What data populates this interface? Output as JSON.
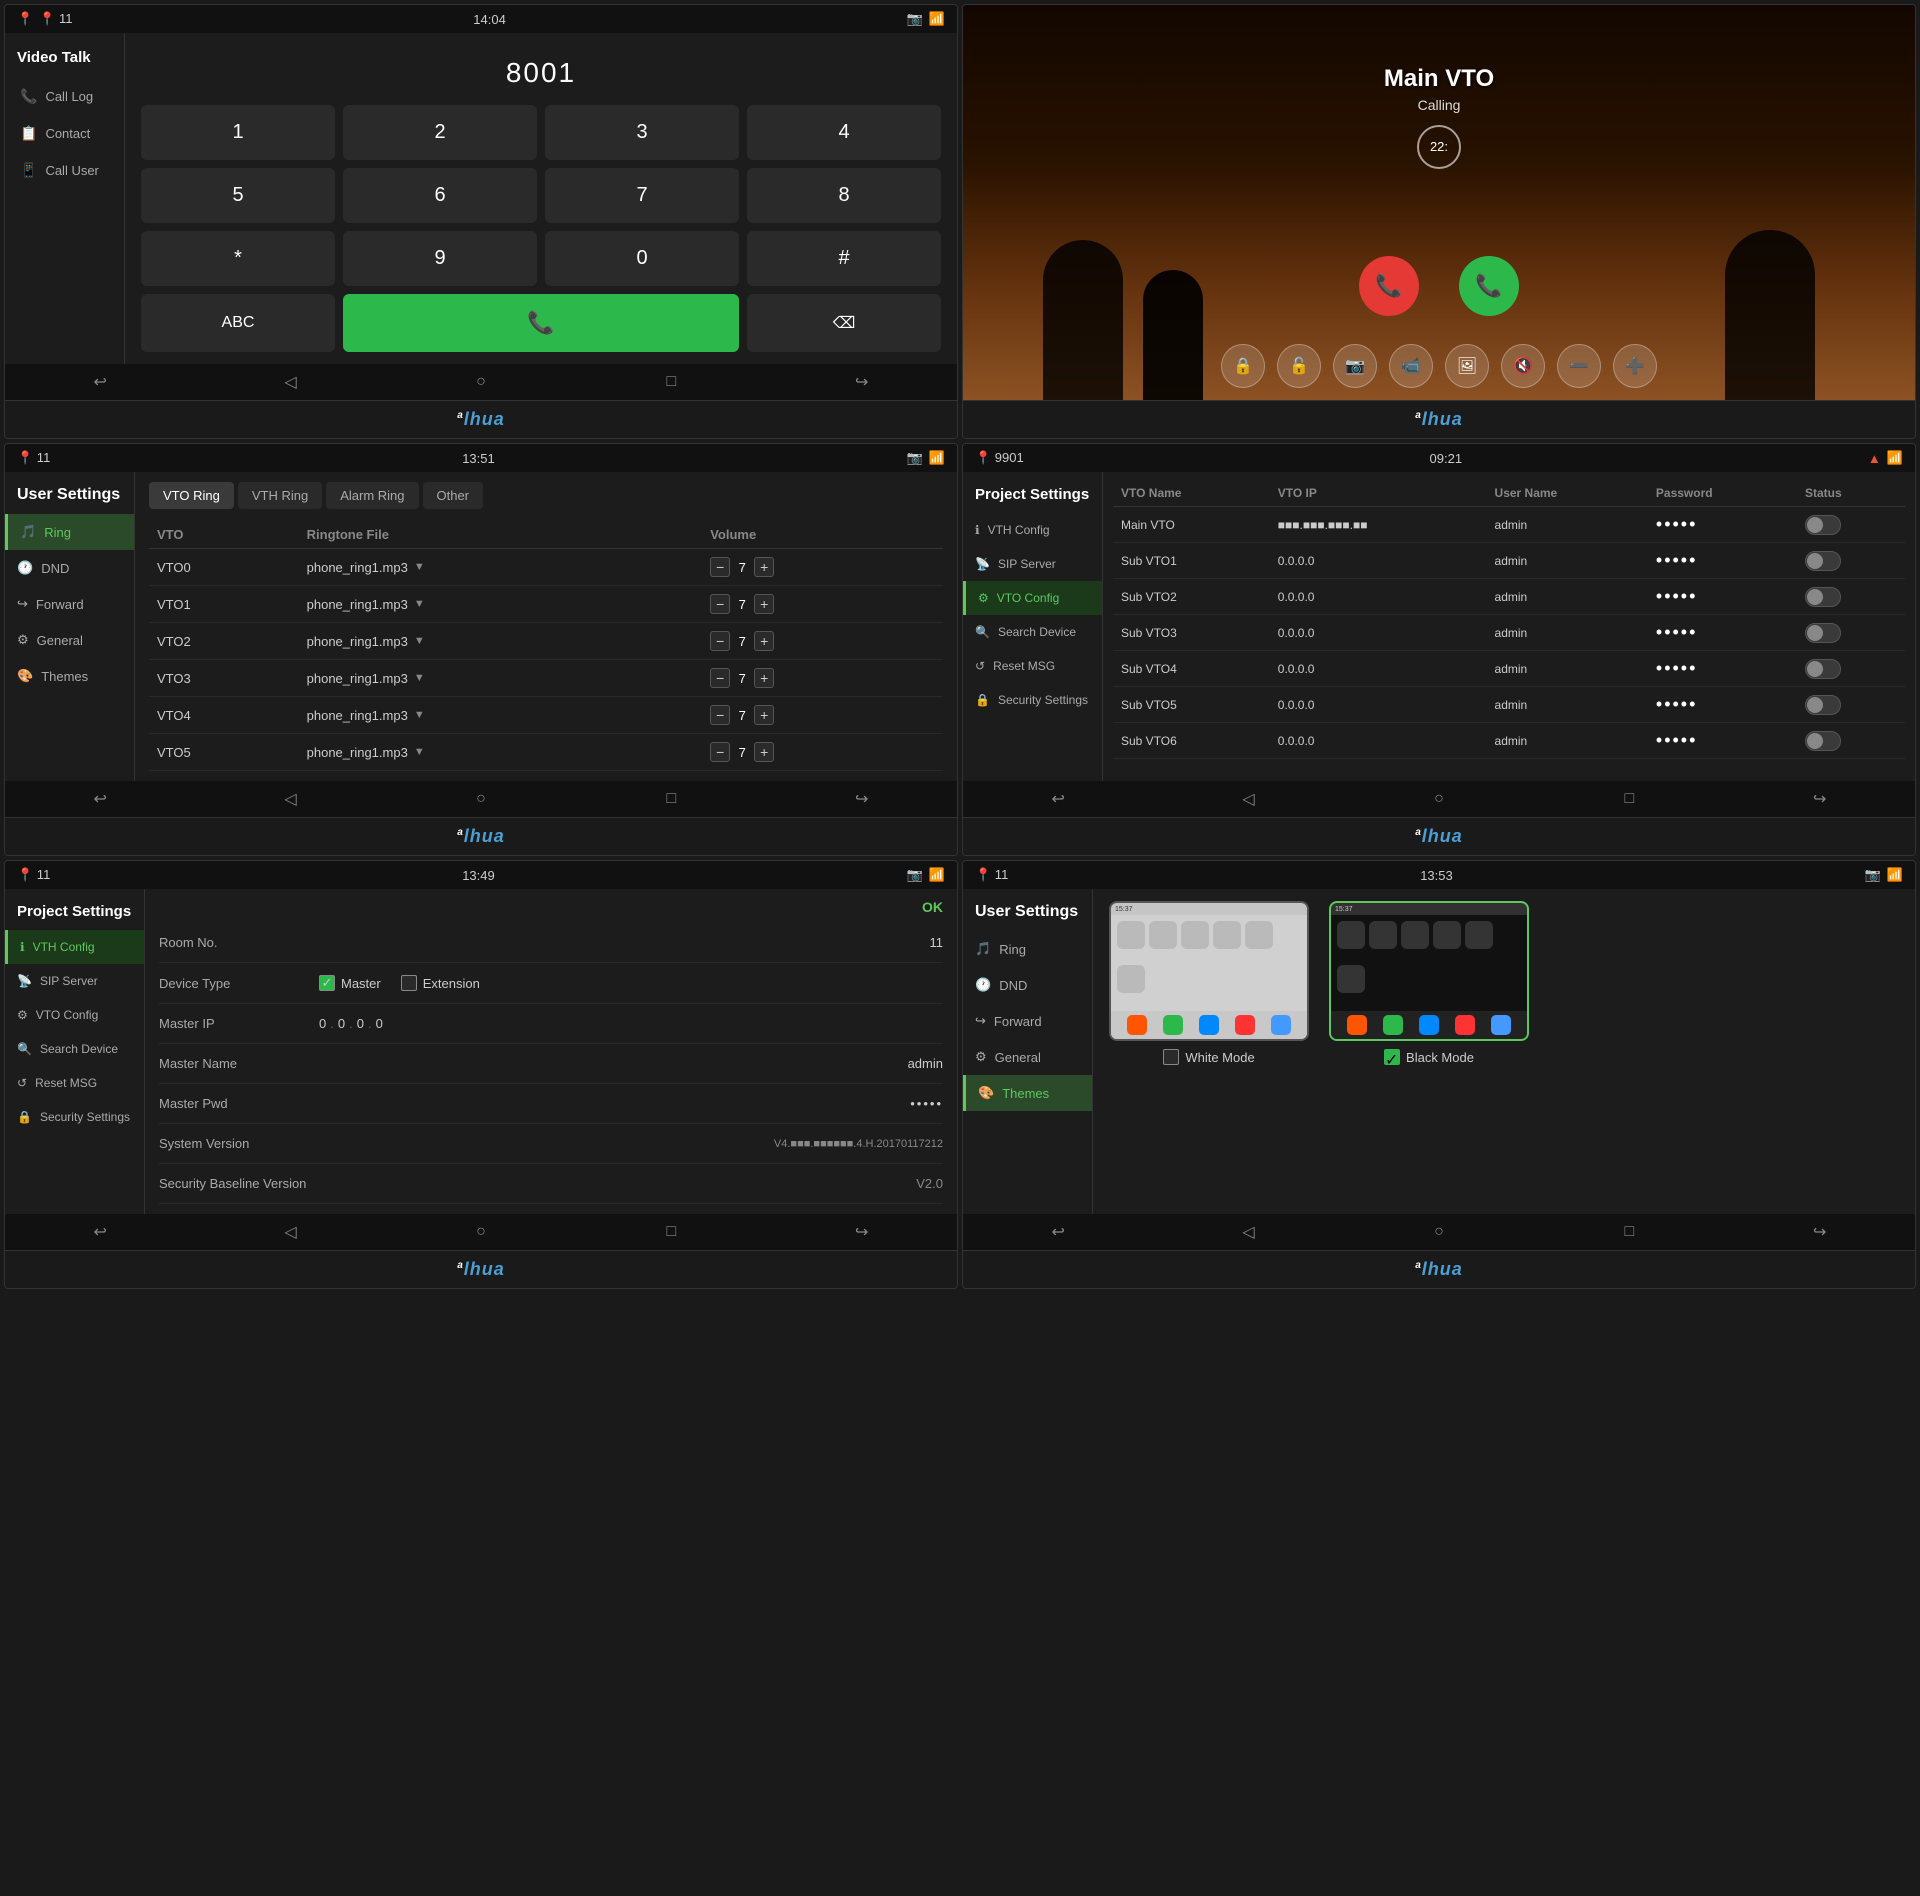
{
  "panels": {
    "p1": {
      "status": {
        "left": "📍 11",
        "time": "14:04",
        "right_icons": [
          "📷",
          "📶"
        ]
      },
      "title": "Video Talk",
      "sidebar": {
        "items": [
          {
            "icon": "📞",
            "label": "Call Log"
          },
          {
            "icon": "📋",
            "label": "Contact"
          },
          {
            "icon": "📱",
            "label": "Call User"
          }
        ]
      },
      "dialpad": {
        "display": "8001",
        "keys": [
          "1",
          "2",
          "3",
          "4",
          "5",
          "6",
          "7",
          "8",
          "*",
          "9",
          "0",
          "#"
        ],
        "abc_label": "ABC",
        "call_icon": "📞"
      },
      "nav": [
        "↩",
        "◁",
        "○",
        "□",
        "↪"
      ]
    },
    "p2": {
      "calling_name": "Main VTO",
      "calling_status": "Calling",
      "timer": "22:",
      "actions": [
        "🔒",
        "🔓",
        "📷",
        "📹",
        "🔍",
        "🔇",
        "➖",
        "➕"
      ]
    },
    "p3": {
      "status": {
        "left": "📍 11",
        "time": "13:51",
        "right_icons": [
          "📷",
          "📶"
        ]
      },
      "title": "User Settings",
      "tabs": [
        "VTO Ring",
        "VTH Ring",
        "Alarm Ring",
        "Other"
      ],
      "active_tab": "VTO Ring",
      "sidebar_items": [
        {
          "icon": "🎵",
          "label": "Ring",
          "active": true
        },
        {
          "icon": "🕐",
          "label": "DND"
        },
        {
          "icon": "↪",
          "label": "Forward"
        },
        {
          "icon": "⚙",
          "label": "General"
        },
        {
          "icon": "🎨",
          "label": "Themes"
        }
      ],
      "table_headers": [
        "VTO",
        "Ringtone File",
        "Volume"
      ],
      "rows": [
        {
          "vto": "VTO0",
          "file": "phone_ring1.mp3",
          "vol": "7"
        },
        {
          "vto": "VTO1",
          "file": "phone_ring1.mp3",
          "vol": "7"
        },
        {
          "vto": "VTO2",
          "file": "phone_ring1.mp3",
          "vol": "7"
        },
        {
          "vto": "VTO3",
          "file": "phone_ring1.mp3",
          "vol": "7"
        },
        {
          "vto": "VTO4",
          "file": "phone_ring1.mp3",
          "vol": "7"
        },
        {
          "vto": "VTO5",
          "file": "phone_ring1.mp3",
          "vol": "7"
        }
      ],
      "nav": [
        "↩",
        "◁",
        "○",
        "□",
        "↪"
      ]
    },
    "p4": {
      "status": {
        "left": "📍 9901",
        "time": "09:21",
        "right_icons": [
          "▲",
          "📶"
        ]
      },
      "title": "Project Settings",
      "sidebar_items": [
        {
          "icon": "ℹ",
          "label": "VTH Config"
        },
        {
          "icon": "📡",
          "label": "SIP Server"
        },
        {
          "icon": "⚙",
          "label": "VTO Config",
          "active": true
        },
        {
          "icon": "🔍",
          "label": "Search Device"
        },
        {
          "icon": "↺",
          "label": "Reset MSG"
        },
        {
          "icon": "🔒",
          "label": "Security Settings"
        }
      ],
      "table_headers": [
        "VTO Name",
        "VTO IP",
        "User Name",
        "Password",
        "Status"
      ],
      "rows": [
        {
          "name": "Main VTO",
          "ip": "■■■.■■■.■■■.■■",
          "username": "admin",
          "password": "•••••",
          "status": false
        },
        {
          "name": "Sub VTO1",
          "ip": "0.0.0.0",
          "username": "admin",
          "password": "•••••",
          "status": false
        },
        {
          "name": "Sub VTO2",
          "ip": "0.0.0.0",
          "username": "admin",
          "password": "•••••",
          "status": false
        },
        {
          "name": "Sub VTO3",
          "ip": "0.0.0.0",
          "username": "admin",
          "password": "•••••",
          "status": false
        },
        {
          "name": "Sub VTO4",
          "ip": "0.0.0.0",
          "username": "admin",
          "password": "•••••",
          "status": false
        },
        {
          "name": "Sub VTO5",
          "ip": "0.0.0.0",
          "username": "admin",
          "password": "•••••",
          "status": false
        },
        {
          "name": "Sub VTO6",
          "ip": "0.0.0.0",
          "username": "admin",
          "password": "•••••",
          "status": false
        }
      ],
      "nav": [
        "↩",
        "◁",
        "○",
        "□",
        "↪"
      ]
    },
    "p5": {
      "status": {
        "left": "📍 11",
        "time": "13:49",
        "right_icons": [
          "📷",
          "📶"
        ]
      },
      "title": "Project Settings",
      "ok_label": "OK",
      "sidebar_items": [
        {
          "icon": "ℹ",
          "label": "VTH Config",
          "active": true
        },
        {
          "icon": "📡",
          "label": "SIP Server"
        },
        {
          "icon": "⚙",
          "label": "VTO Config"
        },
        {
          "icon": "🔍",
          "label": "Search Device"
        },
        {
          "icon": "↺",
          "label": "Reset MSG"
        },
        {
          "icon": "🔒",
          "label": "Security Settings"
        }
      ],
      "form": [
        {
          "label": "Room No.",
          "value": "11"
        },
        {
          "label": "Device Type",
          "value": ""
        },
        {
          "label": "Master IP",
          "value": "0 . 0 . 0 . 0"
        },
        {
          "label": "Master Name",
          "value": "admin"
        },
        {
          "label": "Master Pwd",
          "value": "•••••"
        },
        {
          "label": "System Version",
          "value": "V4.■■■.■■■■■■.4.H.20170117212"
        },
        {
          "label": "Security Baseline Version",
          "value": "V2.0"
        }
      ],
      "device_type": {
        "master_label": "Master",
        "extension_label": "Extension"
      },
      "nav": [
        "↩",
        "◁",
        "○",
        "□",
        "↪"
      ]
    },
    "p6": {
      "status": {
        "left": "📍 11",
        "time": "13:53",
        "right_icons": [
          "📷",
          "📶"
        ]
      },
      "title": "User Settings",
      "sidebar_items": [
        {
          "icon": "🎵",
          "label": "Ring"
        },
        {
          "icon": "🕐",
          "label": "DND"
        },
        {
          "icon": "↪",
          "label": "Forward"
        },
        {
          "icon": "⚙",
          "label": "General"
        },
        {
          "icon": "🎨",
          "label": "Themes",
          "active": true
        }
      ],
      "themes": [
        {
          "label": "White Mode",
          "checked": false
        },
        {
          "label": "Black Mode",
          "checked": true
        }
      ],
      "nav": [
        "↩",
        "◁",
        "○",
        "□",
        "↪"
      ]
    }
  },
  "dahua_label": "alhua"
}
